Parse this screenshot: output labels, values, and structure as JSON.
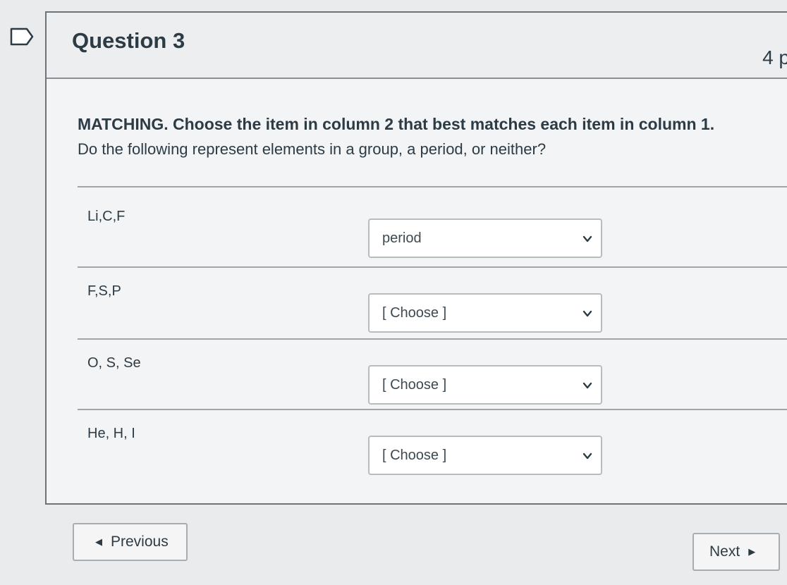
{
  "question": {
    "title": "Question 3",
    "points": "4 p"
  },
  "prompt": {
    "line1": "MATCHING. Choose the item in column 2 that best matches each item in column 1.",
    "line2": "Do the following represent elements in a group, a period, or neither?"
  },
  "rows": [
    {
      "label": "Li,C,F",
      "selected": "period"
    },
    {
      "label": "F,S,P",
      "selected": "[ Choose ]"
    },
    {
      "label": "O, S, Se",
      "selected": "[ Choose ]"
    },
    {
      "label": "He, H, I",
      "selected": "[ Choose ]"
    }
  ],
  "nav": {
    "previous_label": "Previous",
    "next_label": "Next"
  }
}
